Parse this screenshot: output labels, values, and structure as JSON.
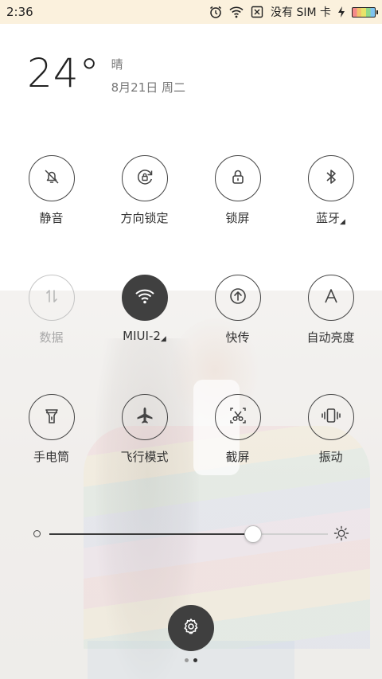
{
  "status_bar": {
    "time": "2:36",
    "carrier_text": "没有 SIM 卡",
    "icons": [
      "alarm-icon",
      "wifi-icon",
      "no-sim-icon",
      "charging-icon",
      "battery-icon"
    ]
  },
  "weather": {
    "temperature": "24°",
    "condition": "晴",
    "date": "8月21日 周二"
  },
  "tiles": [
    {
      "name": "silent",
      "label": "静音",
      "icon": "bell-off-icon",
      "state": "off"
    },
    {
      "name": "rotation-lock",
      "label": "方向锁定",
      "icon": "rotation-lock-icon",
      "state": "off"
    },
    {
      "name": "lock-screen",
      "label": "锁屏",
      "icon": "lock-icon",
      "state": "off"
    },
    {
      "name": "bluetooth",
      "label": "蓝牙",
      "icon": "bluetooth-icon",
      "state": "off",
      "expandable": true
    },
    {
      "name": "mobile-data",
      "label": "数据",
      "icon": "data-arrows-icon",
      "state": "disabled"
    },
    {
      "name": "wifi",
      "label": "MIUI-2",
      "icon": "wifi-icon",
      "state": "on",
      "expandable": true
    },
    {
      "name": "quick-transfer",
      "label": "快传",
      "icon": "upload-icon",
      "state": "off"
    },
    {
      "name": "auto-brightness",
      "label": "自动亮度",
      "icon": "letter-a-icon",
      "state": "off"
    },
    {
      "name": "flashlight",
      "label": "手电筒",
      "icon": "flashlight-icon",
      "state": "off"
    },
    {
      "name": "airplane-mode",
      "label": "飞行模式",
      "icon": "airplane-icon",
      "state": "off"
    },
    {
      "name": "screenshot",
      "label": "截屏",
      "icon": "scissors-icon",
      "state": "off"
    },
    {
      "name": "vibrate",
      "label": "振动",
      "icon": "vibrate-icon",
      "state": "off"
    }
  ],
  "brightness": {
    "level": 0.73,
    "low_icon": "brightness-low-icon",
    "high_icon": "brightness-high-icon"
  },
  "settings": {
    "icon": "gear-icon"
  },
  "pager": {
    "pages": 2,
    "current": 2
  },
  "colors": {
    "status_bar_bg": "#fbf1dd",
    "active_tile": "#404040",
    "disabled": "#c4c4c4"
  }
}
